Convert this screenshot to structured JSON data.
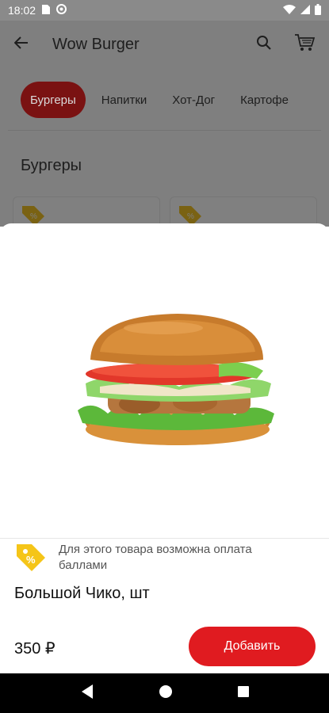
{
  "status_bar": {
    "time": "18:02"
  },
  "app_bar": {
    "title": "Wow Burger"
  },
  "categories": [
    {
      "label": "Бургеры",
      "active": true
    },
    {
      "label": "Напитки",
      "active": false
    },
    {
      "label": "Хот-Дог",
      "active": false
    },
    {
      "label": "Картофе",
      "active": false
    }
  ],
  "section": {
    "title": "Бургеры"
  },
  "product_sheet": {
    "points_note": "Для этого товара возможна оплата баллами",
    "title": "Большой Чико, шт",
    "price": "350 ₽",
    "add_button_label": "Добавить"
  },
  "colors": {
    "accent": "#e01b20",
    "tag_yellow": "#f5c518",
    "scrim": "#7f7f7f"
  },
  "icons": {
    "back": "arrow-left-icon",
    "search": "search-icon",
    "cart": "cart-icon",
    "points_tag": "percent-tag-icon",
    "nav_back": "triangle-back-icon",
    "nav_home": "circle-home-icon",
    "nav_recents": "square-recents-icon"
  }
}
